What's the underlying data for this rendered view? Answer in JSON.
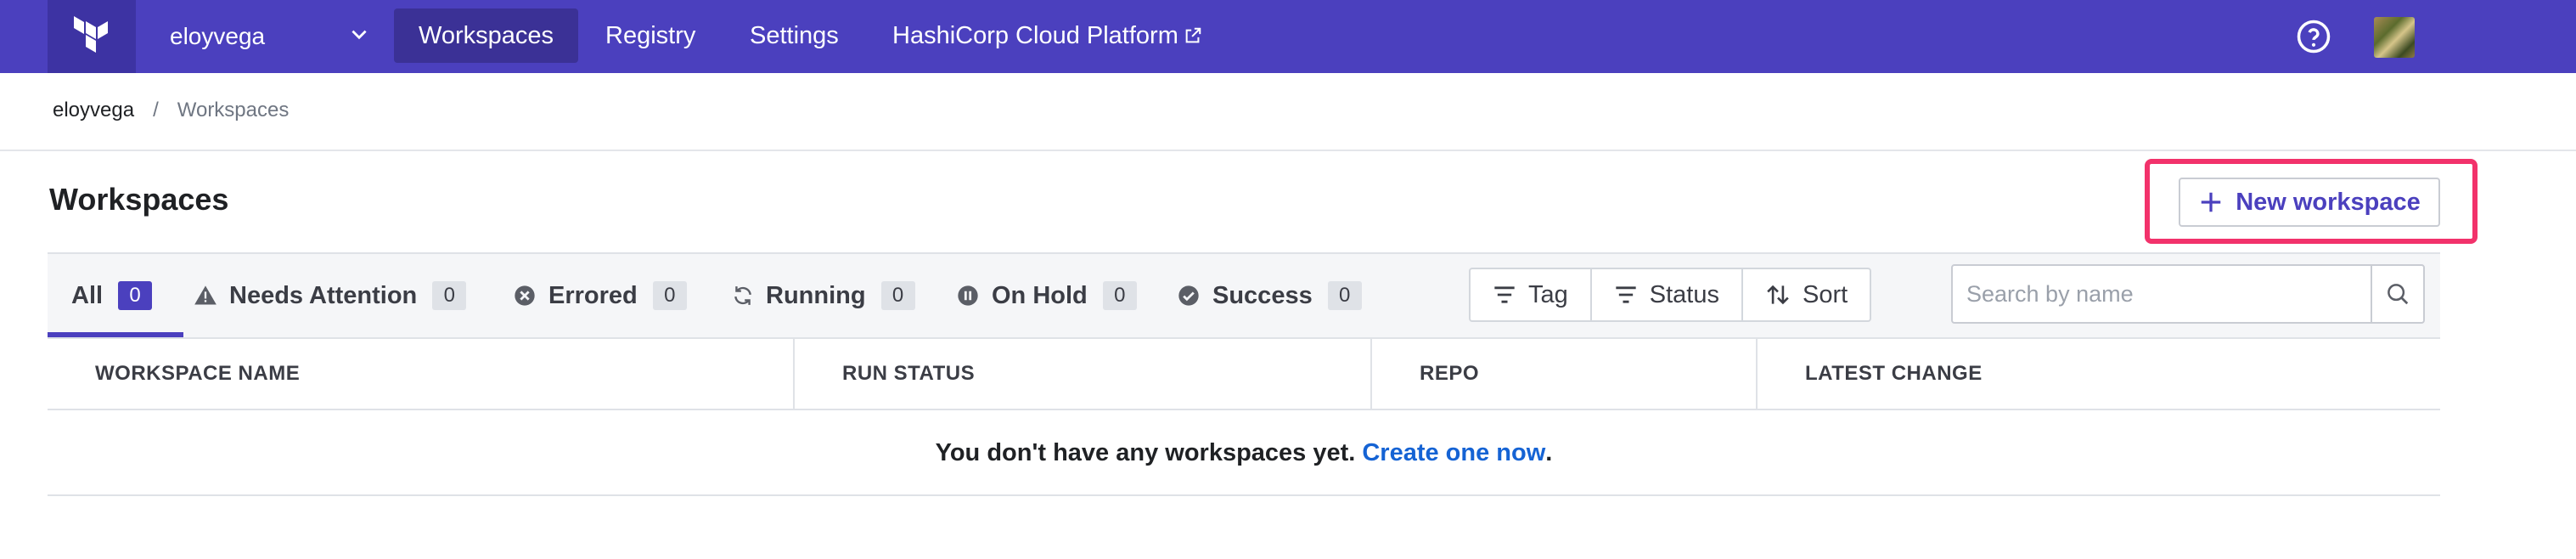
{
  "nav": {
    "org": "eloyvega",
    "links": [
      {
        "label": "Workspaces",
        "active": true
      },
      {
        "label": "Registry"
      },
      {
        "label": "Settings"
      },
      {
        "label": "HashiCorp Cloud Platform"
      }
    ]
  },
  "breadcrumb": {
    "org": "eloyvega",
    "separator": "/",
    "current": "Workspaces"
  },
  "page": {
    "title": "Workspaces",
    "new_button": "New workspace"
  },
  "tabs": [
    {
      "label": "All",
      "count": "0",
      "icon": ""
    },
    {
      "label": "Needs Attention",
      "count": "0",
      "icon": "warning-icon"
    },
    {
      "label": "Errored",
      "count": "0",
      "icon": "x-circle-icon"
    },
    {
      "label": "Running",
      "count": "0",
      "icon": "refresh-icon"
    },
    {
      "label": "On Hold",
      "count": "0",
      "icon": "pause-circle-icon"
    },
    {
      "label": "Success",
      "count": "0",
      "icon": "check-circle-icon"
    }
  ],
  "filters": [
    {
      "label": "Tag",
      "icon": "filter-icon"
    },
    {
      "label": "Status",
      "icon": "filter-icon"
    },
    {
      "label": "Sort",
      "icon": "sort-icon"
    }
  ],
  "search": {
    "placeholder": "Search by name"
  },
  "table": {
    "columns": [
      "WORKSPACE NAME",
      "RUN STATUS",
      "REPO",
      "LATEST CHANGE"
    ],
    "empty_text": "You don't have any workspaces yet.",
    "empty_link": "Create one now",
    "empty_end": "."
  },
  "colors": {
    "brand": "#4b40be",
    "highlight": "#f2326b",
    "link": "#1563d4"
  }
}
